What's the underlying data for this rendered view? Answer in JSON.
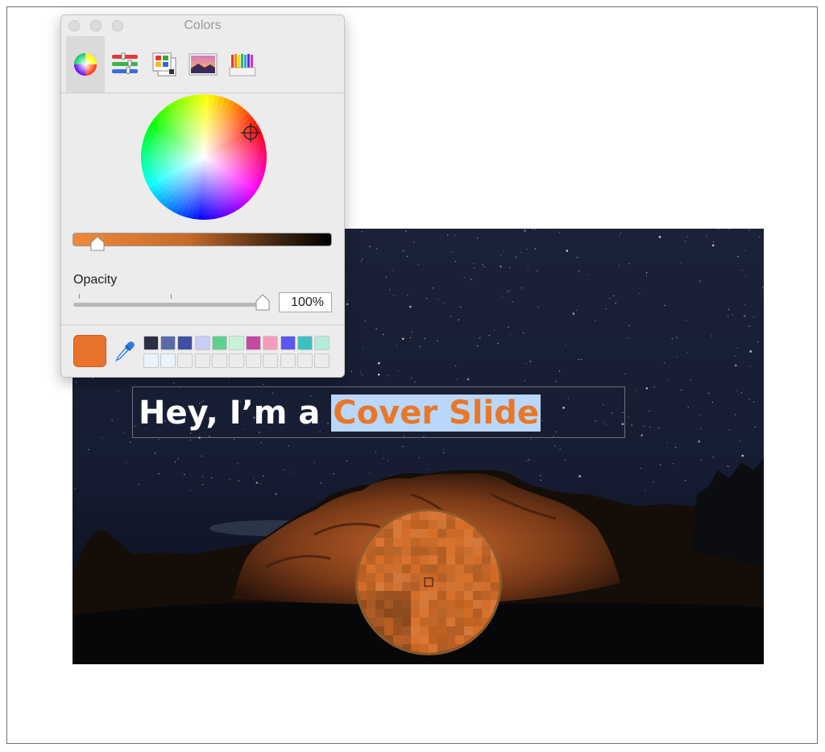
{
  "panel": {
    "title": "Colors",
    "tabs": [
      {
        "name": "color-wheel",
        "active": true
      },
      {
        "name": "color-sliders",
        "active": false
      },
      {
        "name": "color-palettes",
        "active": false
      },
      {
        "name": "image-palettes",
        "active": false
      },
      {
        "name": "pencils",
        "active": false
      }
    ],
    "opacity_label": "Opacity",
    "opacity_value": "100%",
    "brightness_level": 0.06,
    "current_color": "#e8732a",
    "swatches": [
      "#2b2f45",
      "#5a6aa8",
      "#3f4fa3",
      "#c7cdf4",
      "#5fd18f",
      "#c8f2d6",
      "#c24aa0",
      "#f59cbc",
      "#5b57f0",
      "#3ebfc0",
      "#b4ecdc"
    ],
    "empty_swatch_color": "#e8f3fc"
  },
  "slide": {
    "title_plain": "Hey, I’m a ",
    "title_highlight": "Cover Slide",
    "highlight_bg": "#b9d7fb",
    "highlight_text_color": "#e87729"
  }
}
